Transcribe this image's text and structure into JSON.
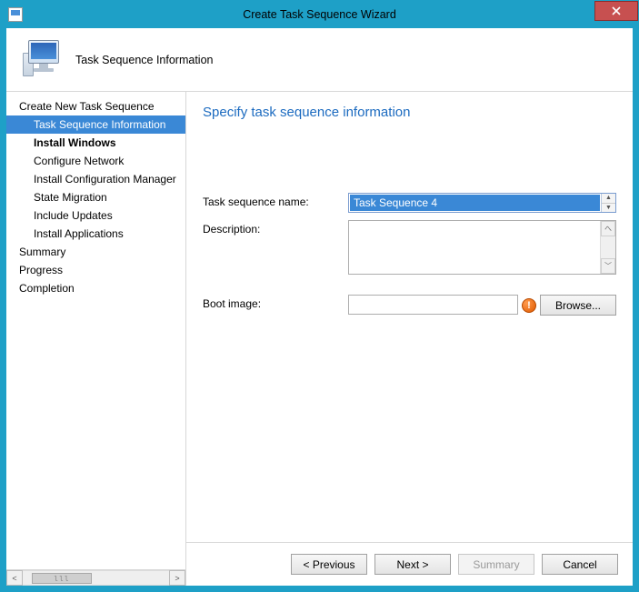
{
  "window": {
    "title": "Create Task Sequence Wizard"
  },
  "header": {
    "title": "Task Sequence Information"
  },
  "nav": {
    "items": [
      {
        "label": "Create New Task Sequence",
        "level": 0,
        "selected": false,
        "bold": false
      },
      {
        "label": "Task Sequence Information",
        "level": 1,
        "selected": true,
        "bold": false
      },
      {
        "label": "Install Windows",
        "level": 1,
        "selected": false,
        "bold": true
      },
      {
        "label": "Configure Network",
        "level": 1,
        "selected": false,
        "bold": false
      },
      {
        "label": "Install Configuration Manager",
        "level": 1,
        "selected": false,
        "bold": false
      },
      {
        "label": "State Migration",
        "level": 1,
        "selected": false,
        "bold": false
      },
      {
        "label": "Include Updates",
        "level": 1,
        "selected": false,
        "bold": false
      },
      {
        "label": "Install Applications",
        "level": 1,
        "selected": false,
        "bold": false
      },
      {
        "label": "Summary",
        "level": 0,
        "selected": false,
        "bold": false
      },
      {
        "label": "Progress",
        "level": 0,
        "selected": false,
        "bold": false
      },
      {
        "label": "Completion",
        "level": 0,
        "selected": false,
        "bold": false
      }
    ]
  },
  "content": {
    "heading": "Specify task sequence information",
    "labels": {
      "task_sequence_name": "Task sequence name:",
      "description": "Description:",
      "boot_image": "Boot image:"
    },
    "values": {
      "task_sequence_name": "Task Sequence 4",
      "description": "",
      "boot_image": ""
    },
    "buttons": {
      "browse": "Browse..."
    }
  },
  "footer": {
    "previous": "< Previous",
    "next": "Next >",
    "summary": "Summary",
    "cancel": "Cancel"
  }
}
